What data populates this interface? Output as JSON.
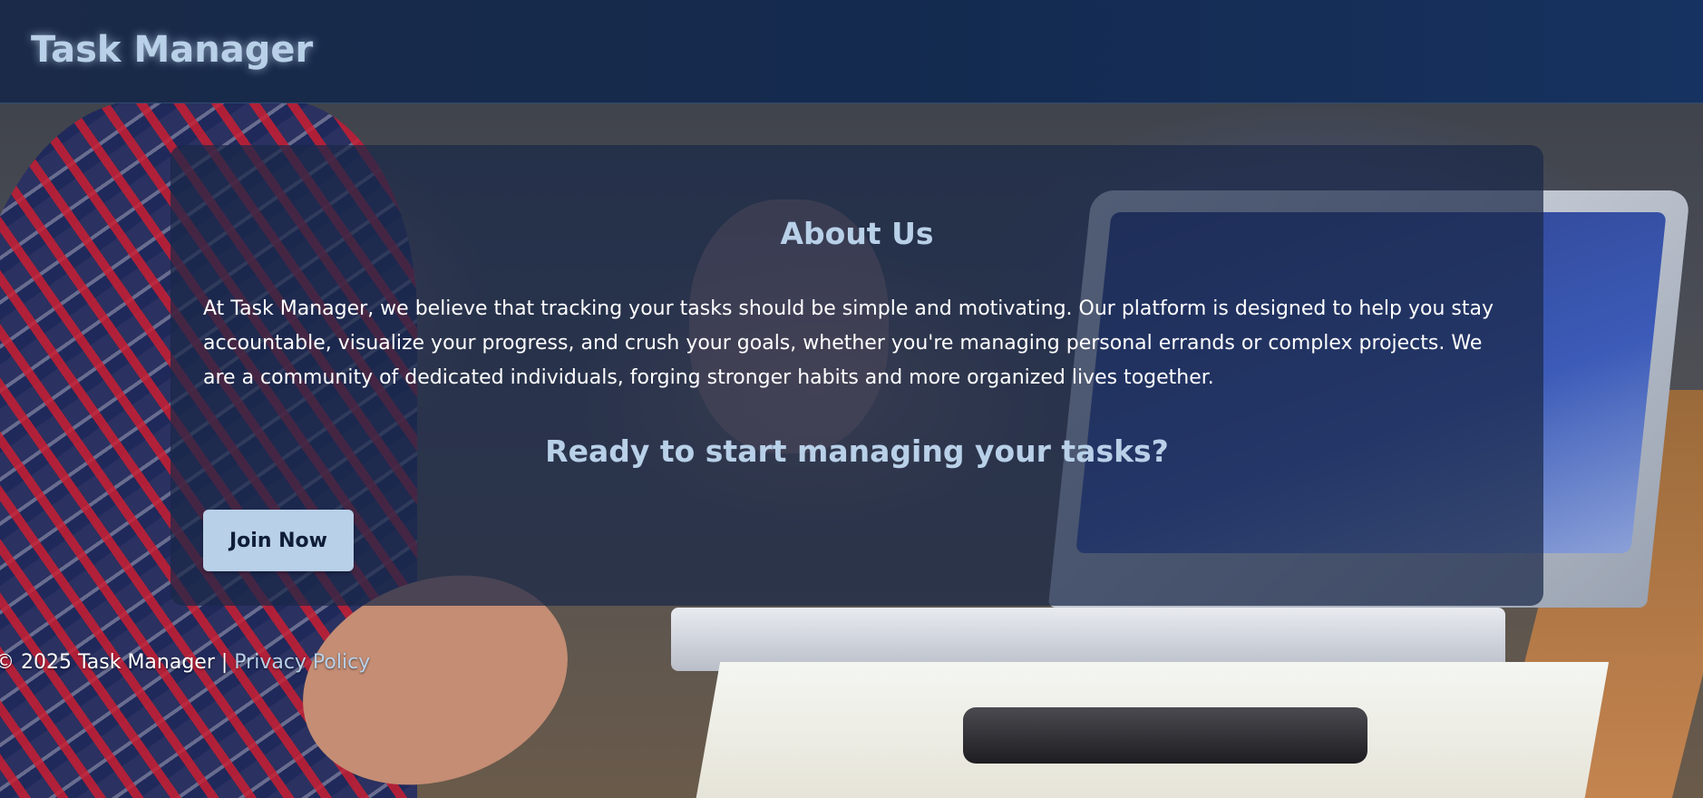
{
  "header": {
    "brand": "Task Manager"
  },
  "about": {
    "title": "About Us",
    "text": "At Task Manager, we believe that tracking your tasks should be simple and motivating. Our platform is designed to help you stay accountable, visualize your progress, and crush your goals, whether you're managing personal errands or complex projects. We are a community of dedicated individuals, forging stronger habits and more organized lives together.",
    "cta_title": "Ready to start managing your tasks?",
    "cta_button": "Join Now"
  },
  "footer": {
    "copyright": "© 2025 Task Manager |",
    "privacy_link": "Privacy Policy"
  },
  "colors": {
    "accent": "#b8d0e8",
    "header_bg": "#142a4e",
    "card_bg": "#1a2848",
    "button_text": "#0f1d36"
  }
}
